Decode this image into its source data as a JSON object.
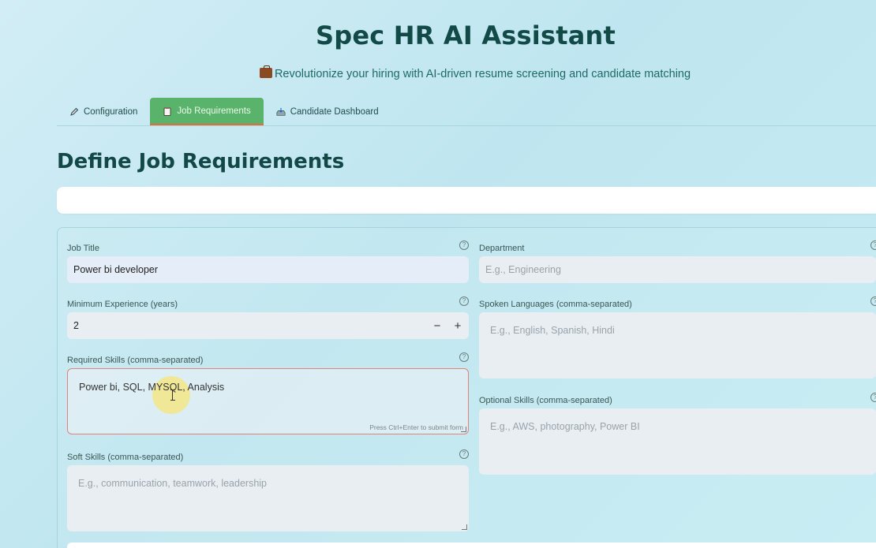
{
  "app": {
    "title": "Spec HR AI Assistant",
    "subtitle": "Revolutionize your hiring with AI-driven resume screening and candidate matching"
  },
  "tabs": [
    {
      "label": "Configuration",
      "icon": "pencil-icon",
      "active": false
    },
    {
      "label": "Job Requirements",
      "icon": "clipboard-icon",
      "active": true
    },
    {
      "label": "Candidate Dashboard",
      "icon": "inbox-tray-icon",
      "active": false
    }
  ],
  "section": {
    "heading": "Define Job Requirements"
  },
  "form": {
    "job_title": {
      "label": "Job Title",
      "value": "Power bi developer"
    },
    "department": {
      "label": "Department",
      "placeholder": "E.g., Engineering"
    },
    "min_experience": {
      "label": "Minimum Experience (years)",
      "value": "2",
      "minus": "−",
      "plus": "+"
    },
    "spoken_languages": {
      "label": "Spoken Languages (comma-separated)",
      "placeholder": "E.g., English, Spanish, Hindi"
    },
    "required_skills": {
      "label": "Required Skills (comma-separated)",
      "value": "Power bi, SQL, MYSQL, Analysis",
      "hint": "Press Ctrl+Enter to submit form"
    },
    "optional_skills": {
      "label": "Optional Skills (comma-separated)",
      "placeholder": "E.g., AWS, photography, Power BI"
    },
    "soft_skills": {
      "label": "Soft Skills (comma-separated)",
      "placeholder": "E.g., communication, teamwork, leadership"
    },
    "help_glyph": "?"
  },
  "colors": {
    "accent": "#5ab36a",
    "active_tab_underline": "#e86a3a",
    "error_border": "#e0837c",
    "heading": "#124845"
  }
}
